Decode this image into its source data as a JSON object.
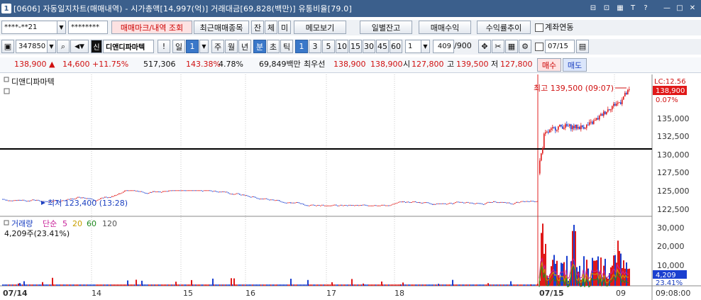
{
  "window": {
    "number": "1",
    "title": "[0606] 자동일지차트(매매내역) - 시가총액[14,997(억)] 거래대금[69,828(백만)] 유통비율[79.0]",
    "controls": [
      "⊟",
      "⊡",
      "▦",
      "T",
      "?",
      "—",
      "□",
      "✕"
    ]
  },
  "toolbar1": {
    "account": "****-**21",
    "password": "********",
    "trade_mark_btn": "매매마크/내역 조회",
    "recent_trade_btn": "최근매매종목",
    "btn_jan": "잔",
    "btn_che": "체",
    "btn_mi": "미",
    "memo_btn": "메모보기",
    "daily_balance_btn": "일별잔고",
    "trade_profit_btn": "매매수익",
    "profit_trend_btn": "수익률추이",
    "account_link_label": "계좌연동"
  },
  "toolbar2": {
    "code": "347850",
    "badge": "신",
    "stock_name": "디앤디파마텍",
    "excl": "!",
    "period_il": "일",
    "period_num": "1",
    "periods": [
      "주",
      "월",
      "년"
    ],
    "period_bun": "분",
    "period_cho": "초",
    "period_tick": "틱",
    "intervals": [
      "1",
      "3",
      "5",
      "10",
      "15",
      "30",
      "45",
      "60"
    ],
    "interval_custom": "1",
    "count_value": "409",
    "count_total": "/900",
    "date_value": "07/15"
  },
  "quote": {
    "price": "138,900 ▲",
    "change": "14,600",
    "change_rate": "+11.75%",
    "volume": "517,306",
    "vol_ratio": "143.38%",
    "turnover_rate": "4.78%",
    "amount": "69,849백만",
    "best_label": "최우선",
    "ask": "138,900",
    "bid": "138,900",
    "open_label": "시",
    "open": "127,800",
    "high_label": "고",
    "high": "139,500",
    "low_label": "저",
    "low": "127,800",
    "buy_btn": "매수",
    "sell_btn": "매도"
  },
  "chart": {
    "legend_name": "디앤디파마텍",
    "high_label": "최고 139,500 (09:07)",
    "low_label": "최저 123,400 (13:28)",
    "lc_label": "LC:12.56",
    "current_price_tag": "138,900",
    "current_pct": "0.07%",
    "price_ticks": [
      "135,000",
      "132,500",
      "130,000",
      "127,500",
      "125,000",
      "122,500"
    ],
    "vol_legend": {
      "name": "거래량",
      "type": "단순",
      "ma5": "5",
      "ma20": "20",
      "ma60": "60",
      "ma120": "120"
    },
    "vol_info": "4,209주(23.41%)",
    "vol_ticks": [
      "30,000",
      "20,000",
      "10,000"
    ],
    "vol_tag": "4,209",
    "vol_pct_tag": "23.41%",
    "x_labels": [
      "07/14",
      "14",
      "15",
      "16",
      "17",
      "18",
      "07/15",
      "09"
    ],
    "time_label": "09:08:00",
    "colors": {
      "up": "#e01818",
      "down": "#1a3fd0",
      "ma5": "#c8229a",
      "ma20": "#c8a000",
      "ma60": "#1f8a1f",
      "ma120": "#555555"
    }
  }
}
